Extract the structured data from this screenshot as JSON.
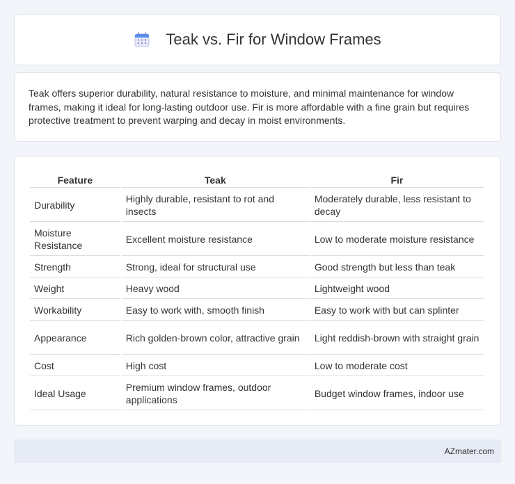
{
  "header": {
    "title": "Teak vs. Fir for Window Frames",
    "icon": "calendar-icon"
  },
  "intro": {
    "text": "Teak offers superior durability, natural resistance to moisture, and minimal maintenance for window frames, making it ideal for long-lasting outdoor use. Fir is more affordable with a fine grain but requires protective treatment to prevent warping and decay in moist environments."
  },
  "table": {
    "headers": [
      "Feature",
      "Teak",
      "Fir"
    ],
    "rows": [
      [
        "Durability",
        "Highly durable, resistant to rot and insects",
        "Moderately durable, less resistant to decay"
      ],
      [
        "Moisture Resistance",
        "Excellent moisture resistance",
        "Low to moderate moisture resistance"
      ],
      [
        "Strength",
        "Strong, ideal for structural use",
        "Good strength but less than teak"
      ],
      [
        "Weight",
        "Heavy wood",
        "Lightweight wood"
      ],
      [
        "Workability",
        "Easy to work with, smooth finish",
        "Easy to work with but can splinter"
      ],
      [
        "Appearance",
        "Rich golden-brown color, attractive grain",
        "Light reddish-brown with straight grain"
      ],
      [
        "Cost",
        "High cost",
        "Low to moderate cost"
      ],
      [
        "Ideal Usage",
        "Premium window frames, outdoor applications",
        "Budget window frames, indoor use"
      ]
    ]
  },
  "footer": {
    "text": "AZmater.com"
  },
  "colors": {
    "background": "#f3f5fa",
    "card": "#ffffff",
    "footer": "#e6ebf5"
  }
}
